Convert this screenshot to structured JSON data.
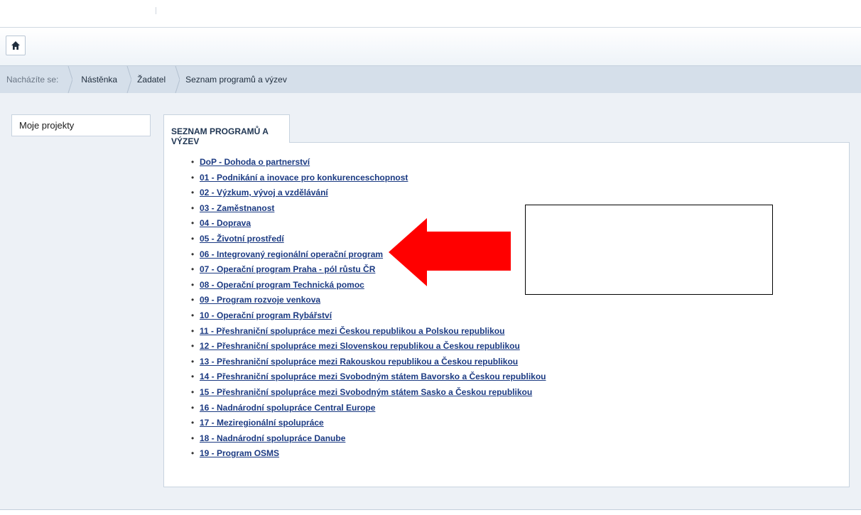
{
  "breadcrumb": {
    "lead": "Nacházíte se:",
    "items": [
      "Nástěnka",
      "Žadatel",
      "Seznam programů a výzev"
    ]
  },
  "sidebar": {
    "items": [
      {
        "label": "Moje projekty"
      }
    ]
  },
  "main": {
    "tab_label": "SEZNAM PROGRAMŮ A VÝZEV",
    "programs": [
      "DoP - Dohoda o partnerství",
      "01 - Podnikání a inovace pro konkurenceschopnost",
      "02 - Výzkum, vývoj a vzdělávání",
      "03 - Zaměstnanost",
      "04 - Doprava",
      "05 - Životní prostředí",
      "06 - Integrovaný regionální operační program",
      "07 - Operační program Praha - pól růstu ČR",
      "08 - Operační program Technická pomoc",
      "09 - Program rozvoje venkova",
      "10 - Operační program Rybářství",
      "11 - Přeshraniční spolupráce mezi Českou republikou a Polskou republikou",
      "12 - Přeshraniční spolupráce mezi Slovenskou republikou a Českou republikou",
      "13 - Přeshraniční spolupráce mezi Rakouskou republikou a Českou republikou",
      "14 - Přeshraniční spolupráce mezi Svobodným státem Bavorsko a Českou republikou",
      "15 - Přeshraniční spolupráce mezi Svobodným státem Sasko a Českou republikou",
      "16 - Nadnárodní spolupráce Central Europe",
      "17 - Meziregionální spolupráce",
      "18 - Nadnárodní spolupráce Danube",
      "19 - Program OSMS"
    ]
  },
  "icons": {
    "home": "home-icon",
    "annotation": "red-arrow-left-icon"
  },
  "colors": {
    "link": "#1b3a82",
    "breadcrumb_bg": "#d5dfea",
    "content_bg": "#edf1f6",
    "arrow": "#ff0000"
  }
}
